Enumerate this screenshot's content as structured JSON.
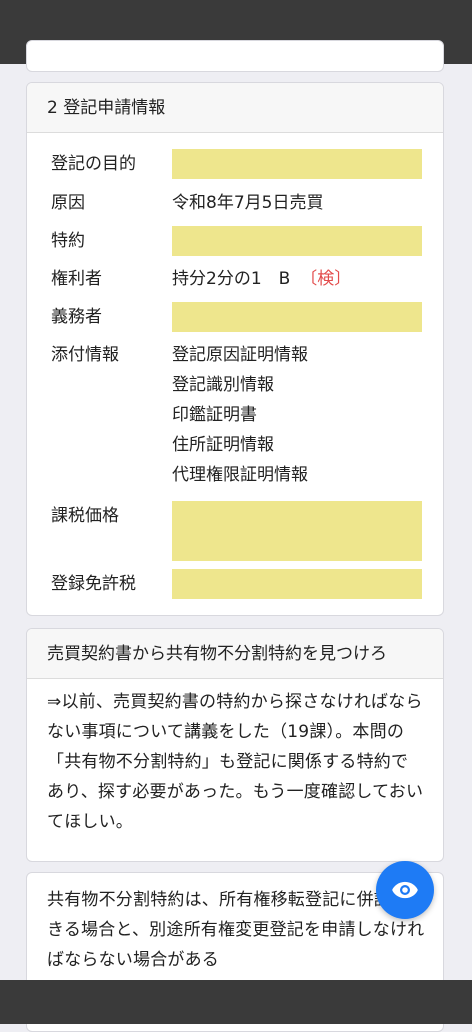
{
  "section_info": {
    "title": "2 登記申請情報",
    "rows": {
      "purpose": {
        "label": "登記の目的"
      },
      "cause": {
        "label": "原因",
        "value": "令和8年7月5日売買"
      },
      "special": {
        "label": "特約"
      },
      "holder": {
        "label": "権利者",
        "value": "持分2分の1　B",
        "tag": "〔検〕"
      },
      "obligor": {
        "label": "義務者"
      },
      "attachments": {
        "label": "添付情報",
        "items": [
          "登記原因証明情報",
          "登記識別情報",
          "印鑑証明書",
          "住所証明情報",
          "代理権限証明情報"
        ]
      },
      "tax_price": {
        "label": "課税価格"
      },
      "license_tax": {
        "label": "登録免許税"
      }
    }
  },
  "question_card": {
    "title": "売買契約書から共有物不分割特約を見つけろ",
    "body": "⇒以前、売買契約書の特約から探さなければならない事項について講義をした（19課）。本問の「共有物不分割特約」も登記に関係する特約であり、探す必要があった。もう一度確認しておいてほしい。"
  },
  "next_card": {
    "body": "共有物不分割特約は、所有権移転登記に併記できる場合と、別途所有権変更登記を申請しなければならない場合がある"
  },
  "colors": {
    "highlight": "#eee68d",
    "tag": "#e34b4b",
    "fab": "#1e7bf5"
  },
  "icons": {
    "fab": "eye-icon"
  }
}
